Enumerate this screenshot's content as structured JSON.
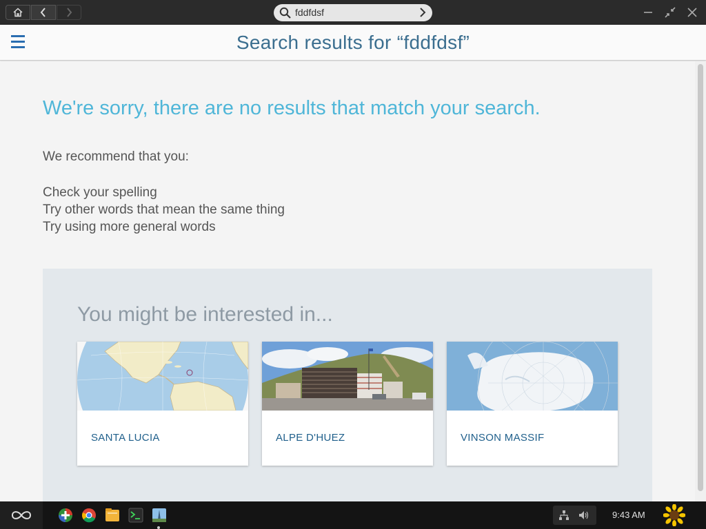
{
  "titlebar": {
    "search_value": "fddfdsf",
    "icons": [
      "home-icon",
      "back-icon",
      "forward-icon",
      "search-icon",
      "go-icon",
      "minimize-icon",
      "restore-icon",
      "close-icon"
    ]
  },
  "header": {
    "title": "Search results for “fddfdsf”"
  },
  "results": {
    "sorry": "We're sorry, there are no results that match your search.",
    "recommend": "We recommend that you:",
    "tips": [
      "Check your spelling",
      "Try other words that mean the same thing",
      "Try using more general words"
    ]
  },
  "interest": {
    "title": "You might be interested in...",
    "cards": [
      {
        "label": "SANTA LUCIA"
      },
      {
        "label": "ALPE D'HUEZ"
      },
      {
        "label": "VINSON MASSIF"
      }
    ]
  },
  "taskbar": {
    "clock": "9:43 AM",
    "apps": [
      "app-store-icon",
      "chrome-icon",
      "files-icon",
      "terminal-icon",
      "photo-app-icon"
    ]
  },
  "colors": {
    "accent": "#4fb6d8",
    "title": "#3b6e8f",
    "card_label": "#1f5f8b",
    "hamburger": "#2a6db0"
  }
}
